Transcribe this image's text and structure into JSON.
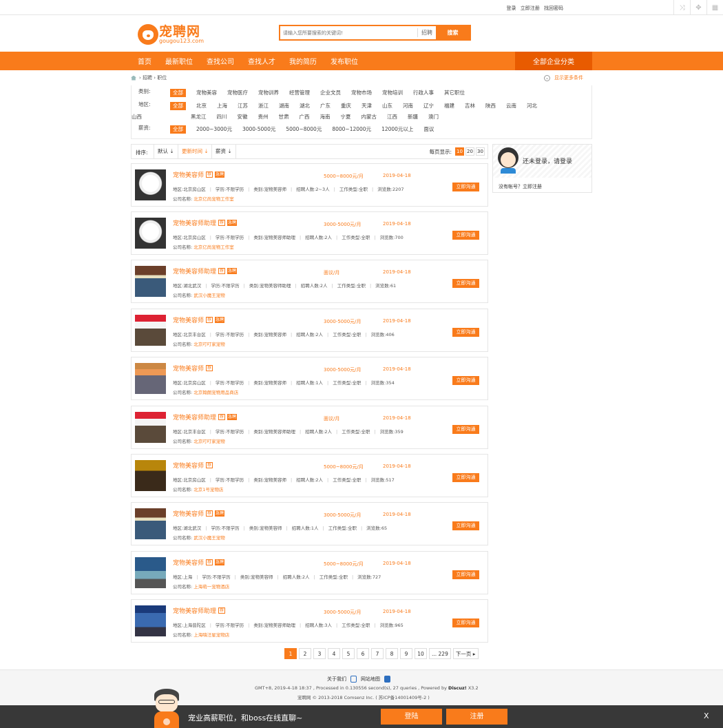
{
  "topbar": {
    "login": "登录",
    "register": "立即注册",
    "find_pwd": "找回密码"
  },
  "logo": {
    "text": "宠聘网",
    "url_text": "gougou123.com"
  },
  "search": {
    "placeholder": "请输入您所要搜索的关键词!",
    "type": "招聘",
    "button": "搜索"
  },
  "nav": {
    "items": [
      "首页",
      "最新职位",
      "查找公司",
      "查找人才",
      "我的简历",
      "发布职位"
    ],
    "right": "全部企业分类"
  },
  "breadcrumb": {
    "items": [
      "招聘",
      "职位"
    ],
    "more": "显示更多条件"
  },
  "filters": {
    "category": {
      "label": "类别:",
      "items": [
        "全部",
        "宠物美容",
        "宠物医疗",
        "宠物训养",
        "经营管理",
        "企业文员",
        "宠物市场",
        "宠物培训",
        "行政人事",
        "其它职位"
      ]
    },
    "region": {
      "label": "地区:",
      "items": [
        "全部",
        "北京",
        "上海",
        "江苏",
        "浙江",
        "湖南",
        "湖北",
        "广东",
        "重庆",
        "天津",
        "山东",
        "河南",
        "辽宁",
        "福建",
        "吉林",
        "陕西",
        "云南",
        "河北",
        "山西",
        "黑龙江",
        "四川",
        "安徽",
        "贵州",
        "甘肃",
        "广西",
        "海南",
        "宁夏",
        "内蒙古",
        "江西",
        "新疆",
        "澳门"
      ]
    },
    "salary": {
      "label": "薪资:",
      "items": [
        "全部",
        "2000~3000元",
        "3000-5000元",
        "5000~8000元",
        "8000~12000元",
        "12000元以上",
        "面议"
      ]
    }
  },
  "sort": {
    "label": "排序:",
    "default": "默认",
    "time": "更新时间",
    "salary": "薪资",
    "per_page_label": "每页显示:",
    "per_page": [
      "10",
      "20",
      "30"
    ]
  },
  "jobs": [
    {
      "title": "宠物美容师",
      "salary": "5000~8000元/月",
      "date": "2019-04-18",
      "region": "地区:北京房山区",
      "edu": "学历:不限学历",
      "cat": "类别:宠物美容师",
      "num": "招聘人数:2~3人",
      "type": "工作类型:全职",
      "views": "浏览数:2207",
      "company_label": "公司名称:",
      "company": "北京亿尚宠物工作室",
      "apply": "立即沟通"
    },
    {
      "title": "宠物美容师助理",
      "salary": "3000-5000元/月",
      "date": "2019-04-18",
      "region": "地区:北京房山区",
      "edu": "学历:不限学历",
      "cat": "类别:宠物美容师助理",
      "num": "招聘人数:2人",
      "type": "工作类型:全职",
      "views": "浏览数:700",
      "company_label": "公司名称:",
      "company": "北京亿尚宠物工作室",
      "apply": "立即沟通"
    },
    {
      "title": "宠物美容师助理",
      "salary": "面议/月",
      "date": "2019-04-18",
      "region": "地区:湖北武汉",
      "edu": "学历:不限学历",
      "cat": "类别:宠物美容师助理",
      "num": "招聘人数:2人",
      "type": "工作类型:全职",
      "views": "浏览数:61",
      "company_label": "公司名称:",
      "company": "武汉小魔王宠物",
      "apply": "立即沟通"
    },
    {
      "title": "宠物美容师",
      "salary": "3000-5000元/月",
      "date": "2019-04-18",
      "region": "地区:北京丰台区",
      "edu": "学历:不限学历",
      "cat": "类别:宠物美容师",
      "num": "招聘人数:2人",
      "type": "工作类型:全职",
      "views": "浏览数:406",
      "company_label": "公司名称:",
      "company": "北京叮叮家宠物",
      "apply": "立即沟通"
    },
    {
      "title": "宠物美容师",
      "salary": "3000-5000元/月",
      "date": "2019-04-18",
      "region": "地区:北京房山区",
      "edu": "学历:不限学历",
      "cat": "类别:宠物美容师",
      "num": "招聘人数:1人",
      "type": "工作类型:全职",
      "views": "浏览数:354",
      "company_label": "公司名称:",
      "company": "北京翰朗宠物用品商店",
      "apply": "立即沟通"
    },
    {
      "title": "宠物美容师助理",
      "salary": "面议/月",
      "date": "2019-04-18",
      "region": "地区:北京丰台区",
      "edu": "学历:不限学历",
      "cat": "类别:宠物美容师助理",
      "num": "招聘人数:2人",
      "type": "工作类型:全职",
      "views": "浏览数:359",
      "company_label": "公司名称:",
      "company": "北京叮叮家宠物",
      "apply": "立即沟通"
    },
    {
      "title": "宠物美容师",
      "salary": "5000~8000元/月",
      "date": "2019-04-18",
      "region": "地区:北京房山区",
      "edu": "学历:不限学历",
      "cat": "类别:宠物美容师",
      "num": "招聘人数:2人",
      "type": "工作类型:全职",
      "views": "浏览数:517",
      "company_label": "公司名称:",
      "company": "北京1号宠物店",
      "apply": "立即沟通"
    },
    {
      "title": "宠物美容师",
      "salary": "3000-5000元/月",
      "date": "2019-04-18",
      "region": "地区:湖北武汉",
      "edu": "学历:不限学历",
      "cat": "类别:宠物美容师",
      "num": "招聘人数:1人",
      "type": "工作类型:全职",
      "views": "浏览数:65",
      "company_label": "公司名称:",
      "company": "武汉小魔王宠物",
      "apply": "立即沟通"
    },
    {
      "title": "宠物美容师",
      "salary": "5000~8000元/月",
      "date": "2019-04-18",
      "region": "地区:上海",
      "edu": "学历:不限学历",
      "cat": "类别:宠物美容师",
      "num": "招聘人数:2人",
      "type": "工作类型:全职",
      "views": "浏览数:727",
      "company_label": "公司名称:",
      "company": "上海萌一宠物酒店",
      "apply": "立即沟通"
    },
    {
      "title": "宠物美容师助理",
      "salary": "3000-5000元/月",
      "date": "2019-04-18",
      "region": "地区:上海普陀区",
      "edu": "学历:不限学历",
      "cat": "类别:宠物美容师助理",
      "num": "招聘人数:3人",
      "type": "工作类型:全职",
      "views": "浏览数:965",
      "company_label": "公司名称:",
      "company": "上海嗨汪星宠物店",
      "apply": "立即沟通"
    }
  ],
  "badges": {
    "rec": "荐",
    "urgent": "急聘"
  },
  "pager": [
    "1",
    "2",
    "3",
    "4",
    "5",
    "6",
    "7",
    "8",
    "9",
    "10",
    "... 229",
    "下一页"
  ],
  "login_box": {
    "msg": "还未登录，请登录",
    "reg": "没有帐号？立即注册"
  },
  "footer": {
    "about": "关于我们",
    "sitemap": "网站地图",
    "line1_pre": "GMT+8, 2019-4-18 18:37 , Processed in 0.130556 second(s), 27 queries , Powered by ",
    "line1_brand": "Discuz!",
    "line1_post": " X3.2",
    "line2": "宠聘网 © 2013-2018 Comsenz Inc. ( 苏ICP备14001409号-2 )"
  },
  "floatbar": {
    "text": "宠业高薪职位，和boss在线直聊~",
    "login": "登陆",
    "register": "注册",
    "close": "X"
  },
  "colors": {
    "accent": "#f97b1b"
  }
}
